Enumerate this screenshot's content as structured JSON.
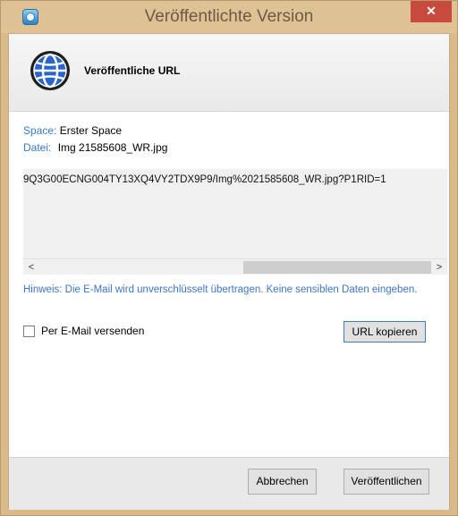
{
  "window": {
    "title": "Veröffentlichte Version",
    "close_symbol": "✕"
  },
  "header": {
    "title": "Veröffentliche URL",
    "icon": "globe-icon"
  },
  "details": {
    "space_label": "Space:",
    "space_value": "Erster Space",
    "file_label": "Datei:",
    "file_value": "Img 21585608_WR.jpg"
  },
  "url_box": {
    "visible_text": "9Q3G00ECNG004TY13XQ4VY2TDX9P9/Img%2021585608_WR.jpg?P1RID=1",
    "scroll_left": "<",
    "scroll_right": ">"
  },
  "hint": "Hinweis: Die E-Mail wird unverschlüsselt übertragen. Keine sensiblen Daten eingeben.",
  "email_option": {
    "label": "Per E-Mail versenden",
    "checked": false
  },
  "buttons": {
    "copy_url": "URL kopieren",
    "cancel": "Abbrechen",
    "publish": "Veröffentlichen"
  },
  "colors": {
    "accent_blue": "#3a77c6",
    "title_bar": "#dfc293",
    "close_red": "#c84a3d"
  }
}
